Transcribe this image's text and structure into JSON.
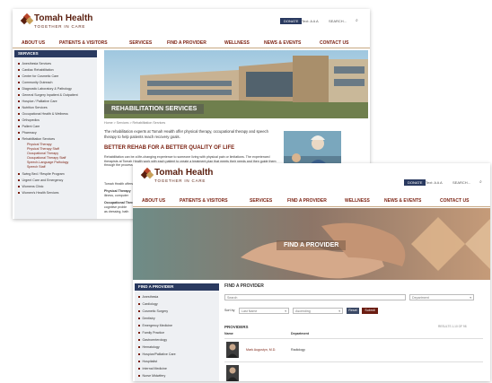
{
  "site": {
    "name": "Tomah Health",
    "tagline": "TOGETHER IN CARE",
    "donate": "DONATE",
    "text_size": "Text: A A A",
    "search": "SEARCH..."
  },
  "nav": [
    "ABOUT US",
    "PATIENTS & VISITORS",
    "SERVICES",
    "FIND A PROVIDER",
    "WELLNESS",
    "NEWS & EVENTS",
    "CONTACT US"
  ],
  "back": {
    "sidebar_title": "SERVICES",
    "sidebar_items": [
      "Anesthesia Services",
      "Cardiac Rehabilitation",
      "Center for Cosmetic Care",
      "Community Outreach",
      "Diagnostic Laboratory & Pathology",
      "General Surgery Inpatient & Outpatient",
      "Hospice / Palliative Care",
      "Nutrition Services",
      "Occupational Health & Wellness",
      "Orthopedics",
      "Pallent Care",
      "Pharmacy",
      "Rehabilitation Services"
    ],
    "sidebar_subitems": [
      "Physical Therapy",
      "Physical Therapy Staff",
      "Occupational Therapy",
      "Occupational Therapy Staff",
      "Speech-Language Pathology",
      "Speech Staff"
    ],
    "sidebar_items_after": [
      "Swing Bed / Respite Program",
      "Urgent Care and Emergency",
      "Womens Clinic",
      "Women's Health Services"
    ],
    "hero_title": "REHABILITATION SERVICES",
    "breadcrumb": "Home > Services > Rehabilitation Services",
    "intro": "The rehabilitation experts at Tomah Health offer physical therapy, occupational therapy and speech therapy to help patients reach recovery goals.",
    "heading": "BETTER REHAB FOR A BETTER QUALITY OF LIFE",
    "para": "Rehabilitation can be a life-changing experience to someone living with physical pain or limitations. The experienced therapists at Tomah Health work with each patient to create a treatment plan that meets their needs and then guide them through the process.",
    "line_a": "Tomah Health offers",
    "line_b": "Physical Therapy",
    "line_c": "illness, computer",
    "line_d": "Occupational Therapy",
    "line_e": "cognitive proble",
    "line_f": "as dressing, bath"
  },
  "front": {
    "hero_title": "FIND A PROVIDER",
    "sidebar_title": "FIND A PROVIDER",
    "sidebar_items": [
      "Anesthesia",
      "Cardiology",
      "Cosmetic Surgery",
      "Dentistry",
      "Emergency Medicine",
      "Family Practice",
      "Gastroenterology",
      "Hematology",
      "Hospice/Palliative Care",
      "Hospitalist",
      "Internal Medicine",
      "Nurse Midwifery"
    ],
    "section_title": "FIND A PROVIDER",
    "search_placeholder": "Search",
    "department_select": "Department",
    "sort_by_label": "Sort by",
    "sort_select": "Last Name",
    "order_select": "Ascending",
    "reset": "Reset",
    "submit": "Submit",
    "providers_title": "PROVIDERS",
    "results_text": "RESULTS 1-10 OF 98",
    "col_name": "Name",
    "col_dept": "Department",
    "providers": [
      {
        "name": "Mark Augustyn, M.D.",
        "department": "Radiology"
      },
      {
        "name": "",
        "department": ""
      }
    ]
  },
  "colors": {
    "brand": "#5a1f0f",
    "accent": "#7a1f0f",
    "sidebar_head": "#2a3a60",
    "submit": "#6b1d12"
  }
}
